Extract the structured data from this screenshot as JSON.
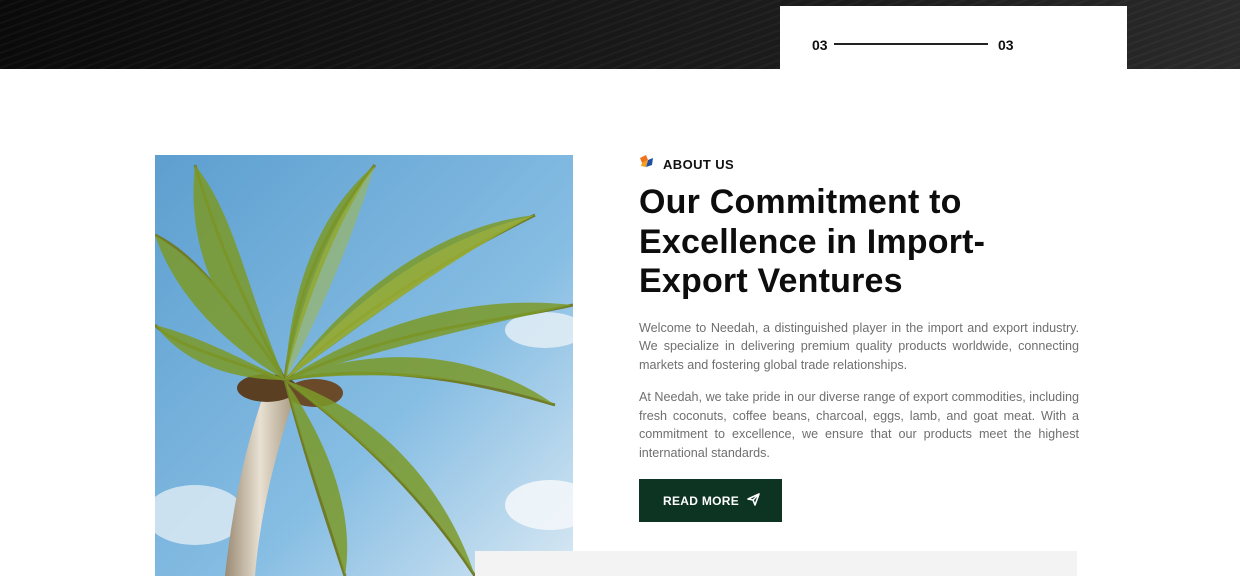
{
  "slider": {
    "current": "03",
    "total": "03"
  },
  "about": {
    "eyebrow": "ABOUT US",
    "title": "Our Commitment to Excellence in Import-Export Ventures",
    "paragraph1": "Welcome to Needah, a distinguished player in the import and export industry. We specialize in delivering premium quality products worldwide, connecting markets and fostering global trade relationships.",
    "paragraph2": "At Needah, we take pride in our diverse range of export commodities, including fresh coconuts, coffee beans, charcoal, eggs, lamb, and goat meat. With a commitment to excellence, we ensure that our products meet the highest international standards.",
    "button_label": "READ MORE",
    "button_icon": "paper-plane-icon",
    "brand_icon": "logo-icon"
  },
  "colors": {
    "button_bg": "#0d3322",
    "heading": "#0d0d0d",
    "body_text": "#6f6f6f",
    "accent_orange": "#f0721c",
    "accent_blue": "#1f4fa3"
  }
}
